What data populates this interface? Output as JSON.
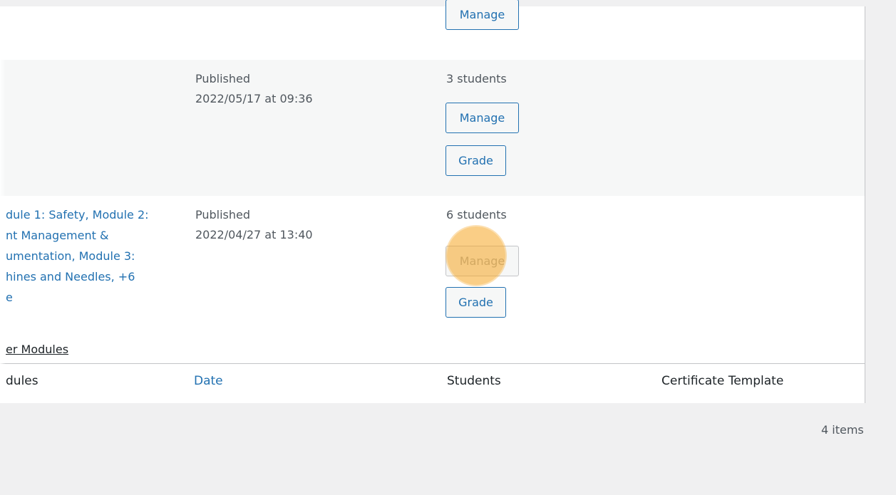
{
  "rows": [
    {
      "buttons": {
        "manage": "Manage"
      }
    },
    {
      "status": "Published",
      "date": "2022/05/17 at 09:36",
      "students": "3 students",
      "buttons": {
        "manage": "Manage",
        "grade": "Grade"
      }
    },
    {
      "modules_lines": [
        "dule 1: Safety, Module 2:",
        "nt Management &",
        "umentation, Module 3:",
        "hines and Needles, +6",
        "e"
      ],
      "filter_link": "er Modules",
      "status": "Published",
      "date": "2022/04/27 at 13:40",
      "students": "6 students",
      "buttons": {
        "manage": "Manage",
        "grade": "Grade"
      }
    }
  ],
  "columns": {
    "modules": "dules",
    "date": "Date",
    "students": "Students",
    "certificate": "Certificate Template"
  },
  "pagination": {
    "items": "4 items"
  },
  "colors": {
    "accent": "#2271b1",
    "highlight": "#f5a623",
    "row_alt": "#f6f7f7",
    "background": "#f0f0f1"
  }
}
